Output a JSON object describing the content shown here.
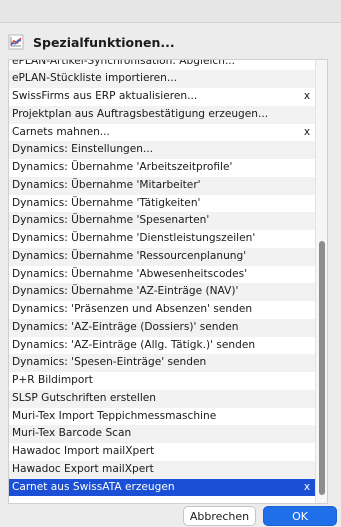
{
  "dialog": {
    "title": "Spezialfunktionen...",
    "icon": "chart-icon"
  },
  "list": {
    "items": [
      {
        "label": "ePLAN-Artikel-Synchronisation: Abgleich...",
        "mark": ""
      },
      {
        "label": "ePLAN-Stückliste importieren...",
        "mark": ""
      },
      {
        "label": "SwissFirms aus ERP aktualisieren...",
        "mark": "x"
      },
      {
        "label": "Projektplan aus Auftragsbestätigung erzeugen...",
        "mark": ""
      },
      {
        "label": "Carnets mahnen...",
        "mark": "x"
      },
      {
        "label": "Dynamics: Einstellungen...",
        "mark": ""
      },
      {
        "label": "Dynamics: Übernahme 'Arbeitszeitprofile'",
        "mark": ""
      },
      {
        "label": "Dynamics: Übernahme 'Mitarbeiter'",
        "mark": ""
      },
      {
        "label": "Dynamics: Übernahme 'Tätigkeiten'",
        "mark": ""
      },
      {
        "label": "Dynamics: Übernahme 'Spesenarten'",
        "mark": ""
      },
      {
        "label": "Dynamics: Übernahme 'Dienstleistungszeilen'",
        "mark": ""
      },
      {
        "label": "Dynamics: Übernahme 'Ressourcenplanung'",
        "mark": ""
      },
      {
        "label": "Dynamics: Übernahme 'Abwesenheitscodes'",
        "mark": ""
      },
      {
        "label": "Dynamics: Übernahme 'AZ-Einträge (NAV)'",
        "mark": ""
      },
      {
        "label": "Dynamics: 'Präsenzen und Absenzen' senden",
        "mark": ""
      },
      {
        "label": "Dynamics: 'AZ-Einträge (Dossiers)' senden",
        "mark": ""
      },
      {
        "label": "Dynamics: 'AZ-Einträge (Allg. Tätigk.)' senden",
        "mark": ""
      },
      {
        "label": "Dynamics: 'Spesen-Einträge' senden",
        "mark": ""
      },
      {
        "label": "P+R Bildimport",
        "mark": ""
      },
      {
        "label": "SLSP Gutschriften erstellen",
        "mark": ""
      },
      {
        "label": "Muri-Tex Import Teppichmessmaschine",
        "mark": ""
      },
      {
        "label": "Muri-Tex Barcode Scan",
        "mark": ""
      },
      {
        "label": "Hawadoc Import mailXpert",
        "mark": ""
      },
      {
        "label": "Hawadoc Export mailXpert",
        "mark": ""
      },
      {
        "label": "Carnet aus SwissATA erzeugen",
        "mark": "x",
        "selected": true
      }
    ]
  },
  "buttons": {
    "cancel_label": "Abbrechen",
    "ok_label": "OK"
  },
  "colors": {
    "selection": "#1a4fd6",
    "ok_button": "#1f6fe8",
    "dialog_background": "#ececec"
  }
}
